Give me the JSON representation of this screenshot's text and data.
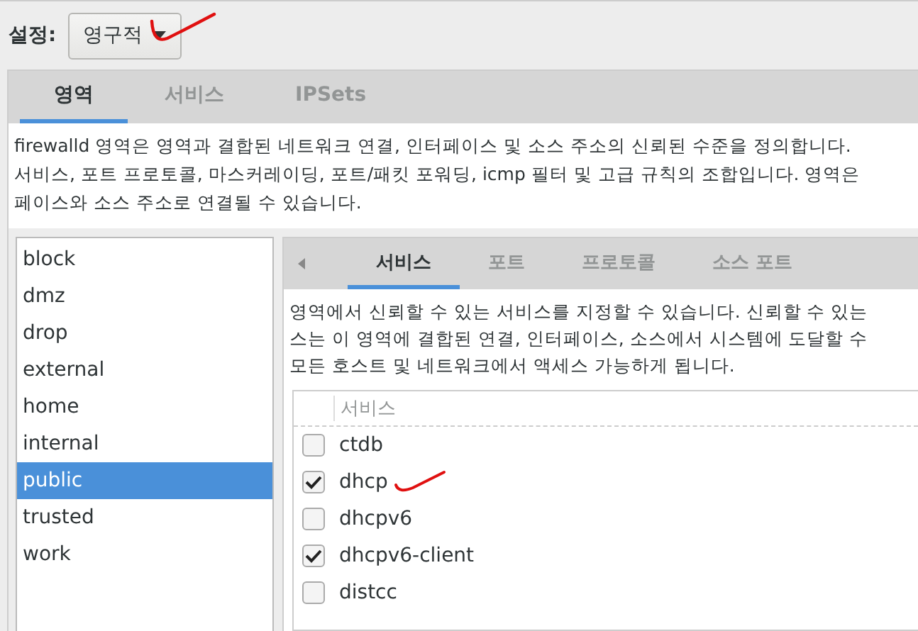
{
  "settings": {
    "label": "설정:",
    "value": "영구적"
  },
  "tabs": [
    {
      "label": "영역",
      "selected": true
    },
    {
      "label": "서비스",
      "selected": false
    },
    {
      "label": "IPSets",
      "selected": false
    }
  ],
  "description": [
    "firewalld 영역은 영역과 결합된 네트워크 연결, 인터페이스 및 소스 주소의 신뢰된 수준을 정의합니다.",
    "서비스, 포트 프로토콜, 마스커레이딩, 포트/패킷 포워딩, icmp 필터 및 고급 규칙의 조합입니다. 영역은",
    "페이스와 소스 주소로 연결될 수 있습니다."
  ],
  "zones": [
    {
      "name": "block",
      "selected": false
    },
    {
      "name": "dmz",
      "selected": false
    },
    {
      "name": "drop",
      "selected": false
    },
    {
      "name": "external",
      "selected": false
    },
    {
      "name": "home",
      "selected": false
    },
    {
      "name": "internal",
      "selected": false
    },
    {
      "name": "public",
      "selected": true
    },
    {
      "name": "trusted",
      "selected": false
    },
    {
      "name": "work",
      "selected": false
    }
  ],
  "zone_tabs": [
    {
      "label": "서비스",
      "selected": true
    },
    {
      "label": "포트",
      "selected": false
    },
    {
      "label": "프로토콜",
      "selected": false
    },
    {
      "label": "소스 포트",
      "selected": false
    }
  ],
  "services_description": [
    "영역에서 신뢰할 수 있는 서비스를 지정할 수 있습니다. 신뢰할 수 있는",
    "스는 이 영역에 결합된 연결, 인터페이스, 소스에서 시스템에 도달할 수",
    "모든 호스트 및 네트워크에서 액세스 가능하게 됩니다."
  ],
  "services_table": {
    "columns": [
      "서비스"
    ],
    "rows": [
      {
        "name": "ctdb",
        "checked": false
      },
      {
        "name": "dhcp",
        "checked": true
      },
      {
        "name": "dhcpv6",
        "checked": false
      },
      {
        "name": "dhcpv6-client",
        "checked": true
      },
      {
        "name": "distcc",
        "checked": false
      }
    ]
  }
}
